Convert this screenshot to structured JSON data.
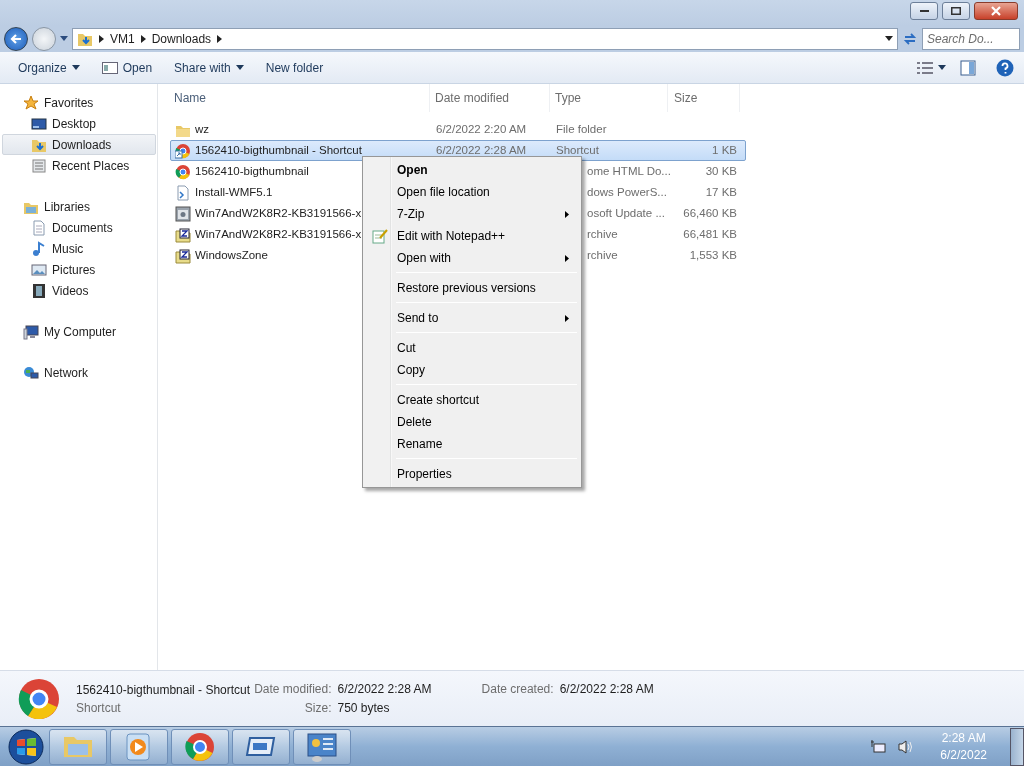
{
  "address": {
    "crumbs": [
      "VM1",
      "Downloads"
    ]
  },
  "search": {
    "placeholder": "Search Do..."
  },
  "toolbar": [
    {
      "label": "Organize",
      "dropdown": true,
      "icon": false
    },
    {
      "label": "Open",
      "dropdown": false,
      "icon": true
    },
    {
      "label": "Share with",
      "dropdown": true,
      "icon": false
    },
    {
      "label": "New folder",
      "dropdown": false,
      "icon": false
    }
  ],
  "nav": [
    {
      "label": "Favorites",
      "selected": false,
      "children": [
        {
          "label": "Desktop",
          "selected": false
        },
        {
          "label": "Downloads",
          "selected": true
        },
        {
          "label": "Recent Places",
          "selected": false
        }
      ]
    },
    {
      "label": "Libraries",
      "selected": false,
      "children": [
        {
          "label": "Documents",
          "selected": false
        },
        {
          "label": "Music",
          "selected": false
        },
        {
          "label": "Pictures",
          "selected": false
        },
        {
          "label": "Videos",
          "selected": false
        }
      ]
    },
    {
      "label": "My Computer",
      "selected": false
    },
    {
      "label": "Network",
      "selected": false
    }
  ],
  "columns": [
    "Name",
    "Date modified",
    "Type",
    "Size"
  ],
  "files": [
    {
      "name": "wz",
      "kind": "folder",
      "date": "6/2/2022 2:20 AM",
      "type": "File folder",
      "type_cut": false,
      "selected": false
    },
    {
      "name": "1562410-bigthumbnail - Shortcut",
      "kind": "shortcut",
      "date": "6/2/2022 2:28 AM",
      "type": "Shortcut",
      "type_cut": false,
      "size": "1 KB",
      "selected": true
    },
    {
      "name": "1562410-bigthumbnail",
      "kind": "html",
      "type": "ome HTML Do...",
      "type_cut": true,
      "size": "30 KB",
      "selected": false
    },
    {
      "name": "Install-WMF5.1",
      "kind": "script",
      "type": "dows PowerS...",
      "type_cut": true,
      "size": "17 KB",
      "selected": false
    },
    {
      "name": "Win7AndW2K8R2-KB3191566-x",
      "kind": "update",
      "type": "osoft Update ...",
      "type_cut": true,
      "size": "66,460 KB",
      "selected": false
    },
    {
      "name": "Win7AndW2K8R2-KB3191566-x",
      "kind": "archive",
      "type": "rchive",
      "type_cut": true,
      "size": "66,481 KB",
      "selected": false
    },
    {
      "name": "WindowsZone",
      "kind": "archive",
      "type": "rchive",
      "type_cut": true,
      "size": "1,553 KB",
      "selected": false
    }
  ],
  "context_menu": [
    {
      "kind": "item",
      "label": "Open",
      "default": true,
      "submenu": false,
      "icon": false
    },
    {
      "kind": "item",
      "label": "Open file location",
      "default": false,
      "submenu": false,
      "icon": false
    },
    {
      "kind": "item",
      "label": "7-Zip",
      "default": false,
      "submenu": true,
      "icon": false
    },
    {
      "kind": "item",
      "label": "Edit with Notepad++",
      "default": false,
      "submenu": false,
      "icon": true
    },
    {
      "kind": "item",
      "label": "Open with",
      "default": false,
      "submenu": true,
      "icon": false
    },
    {
      "kind": "separator"
    },
    {
      "kind": "item",
      "label": "Restore previous versions",
      "default": false,
      "submenu": false,
      "icon": false
    },
    {
      "kind": "separator"
    },
    {
      "kind": "item",
      "label": "Send to",
      "default": false,
      "submenu": true,
      "icon": false
    },
    {
      "kind": "separator"
    },
    {
      "kind": "item",
      "label": "Cut",
      "default": false,
      "submenu": false,
      "icon": false
    },
    {
      "kind": "item",
      "label": "Copy",
      "default": false,
      "submenu": false,
      "icon": false
    },
    {
      "kind": "separator"
    },
    {
      "kind": "item",
      "label": "Create shortcut",
      "default": false,
      "submenu": false,
      "icon": false
    },
    {
      "kind": "item",
      "label": "Delete",
      "default": false,
      "submenu": false,
      "icon": false
    },
    {
      "kind": "item",
      "label": "Rename",
      "default": false,
      "submenu": false,
      "icon": false
    },
    {
      "kind": "separator"
    },
    {
      "kind": "item",
      "label": "Properties",
      "default": false,
      "submenu": false,
      "icon": false
    }
  ],
  "details": {
    "name": "1562410-bigthumbnail - Shortcut",
    "type": "Shortcut",
    "fields": [
      {
        "label": "Date modified:",
        "value": "6/2/2022 2:28 AM"
      },
      {
        "label": "Size:",
        "value": "750 bytes"
      },
      {
        "label": "Date created:",
        "value": "6/2/2022 2:28 AM"
      }
    ]
  },
  "taskbar": {
    "time": "2:28 AM",
    "date": "6/2/2022"
  }
}
